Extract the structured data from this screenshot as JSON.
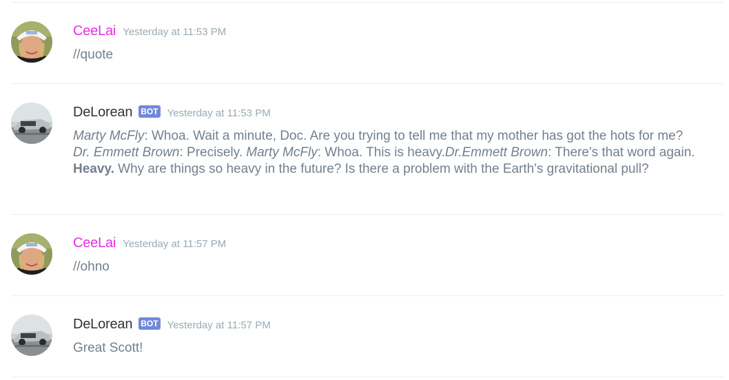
{
  "messages": [
    {
      "author": "CeeLai",
      "author_color": "#e82de8",
      "bot_tag": "",
      "timestamp": "Yesterday at 11:53 PM",
      "text": "//quote",
      "avatar": "user-avatar"
    },
    {
      "author": "DeLorean",
      "author_color": "#2e3338",
      "bot_tag": "BOT",
      "timestamp": "Yesterday at 11:53 PM",
      "avatar": "car-avatar",
      "segments": [
        {
          "t": "Marty McFly",
          "s": "em"
        },
        {
          "t": ": Whoa. Wait a minute, Doc. Are you trying to tell me that my mother has got the hots for me? ",
          "s": ""
        },
        {
          "t": "Dr. Emmett Brown",
          "s": "em"
        },
        {
          "t": ": Precisely. ",
          "s": ""
        },
        {
          "t": "Marty McFly",
          "s": "em"
        },
        {
          "t": ": Whoa. This is heavy.",
          "s": ""
        },
        {
          "t": "Dr.Emmett Brown",
          "s": "em"
        },
        {
          "t": ": There's that word again. ",
          "s": ""
        },
        {
          "t": "Heavy.",
          "s": "strong"
        },
        {
          "t": " Why are things so heavy in the future? Is there a problem with the Earth's gravitational pull?",
          "s": ""
        }
      ]
    },
    {
      "author": "CeeLai",
      "author_color": "#e82de8",
      "bot_tag": "",
      "timestamp": "Yesterday at 11:57 PM",
      "text": "//ohno",
      "avatar": "user-avatar"
    },
    {
      "author": "DeLorean",
      "author_color": "#2e3338",
      "bot_tag": "BOT",
      "timestamp": "Yesterday at 11:57 PM",
      "text": "Great Scott!",
      "avatar": "car-avatar"
    }
  ]
}
